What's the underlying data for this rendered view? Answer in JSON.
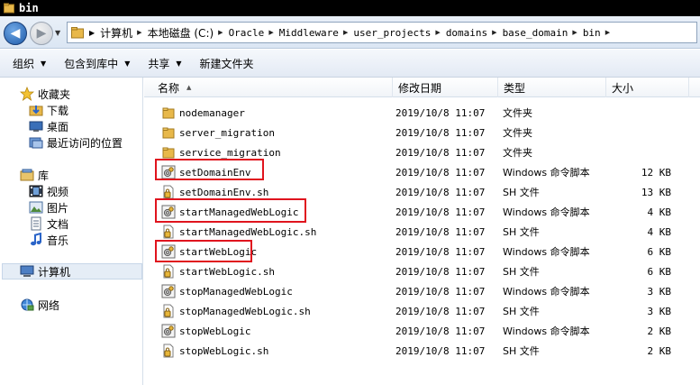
{
  "window": {
    "title": "bin"
  },
  "address": {
    "crumbs": [
      "计算机",
      "本地磁盘 (C:)",
      "Oracle",
      "Middleware",
      "user_projects",
      "domains",
      "base_domain",
      "bin"
    ]
  },
  "toolbar": {
    "organize": "组织",
    "include_in_library": "包含到库中",
    "share": "共享",
    "new_folder": "新建文件夹"
  },
  "navpane": {
    "favorites": "收藏夹",
    "downloads": "下载",
    "desktop": "桌面",
    "recent": "最近访问的位置",
    "libraries": "库",
    "videos": "视频",
    "pictures": "图片",
    "documents": "文档",
    "music": "音乐",
    "computer": "计算机",
    "network": "网络"
  },
  "columns": {
    "name": "名称",
    "date": "修改日期",
    "type": "类型",
    "size": "大小"
  },
  "files": [
    {
      "name": "nodemanager",
      "date": "2019/10/8 11:07",
      "type": "文件夹",
      "size": "",
      "icon": "folder-icon"
    },
    {
      "name": "server_migration",
      "date": "2019/10/8 11:07",
      "type": "文件夹",
      "size": "",
      "icon": "folder-icon"
    },
    {
      "name": "service_migration",
      "date": "2019/10/8 11:07",
      "type": "文件夹",
      "size": "",
      "icon": "folder-icon"
    },
    {
      "name": "setDomainEnv",
      "date": "2019/10/8 11:07",
      "type": "Windows 命令脚本",
      "size": "12 KB",
      "icon": "batch-file-icon"
    },
    {
      "name": "setDomainEnv.sh",
      "date": "2019/10/8 11:07",
      "type": "SH 文件",
      "size": "13 KB",
      "icon": "sh-file-icon"
    },
    {
      "name": "startManagedWebLogic",
      "date": "2019/10/8 11:07",
      "type": "Windows 命令脚本",
      "size": "4 KB",
      "icon": "batch-file-icon"
    },
    {
      "name": "startManagedWebLogic.sh",
      "date": "2019/10/8 11:07",
      "type": "SH 文件",
      "size": "4 KB",
      "icon": "sh-file-icon"
    },
    {
      "name": "startWebLogic",
      "date": "2019/10/8 11:07",
      "type": "Windows 命令脚本",
      "size": "6 KB",
      "icon": "batch-file-icon"
    },
    {
      "name": "startWebLogic.sh",
      "date": "2019/10/8 11:07",
      "type": "SH 文件",
      "size": "6 KB",
      "icon": "sh-file-icon"
    },
    {
      "name": "stopManagedWebLogic",
      "date": "2019/10/8 11:07",
      "type": "Windows 命令脚本",
      "size": "3 KB",
      "icon": "batch-file-icon"
    },
    {
      "name": "stopManagedWebLogic.sh",
      "date": "2019/10/8 11:07",
      "type": "SH 文件",
      "size": "3 KB",
      "icon": "sh-file-icon"
    },
    {
      "name": "stopWebLogic",
      "date": "2019/10/8 11:07",
      "type": "Windows 命令脚本",
      "size": "2 KB",
      "icon": "batch-file-icon"
    },
    {
      "name": "stopWebLogic.sh",
      "date": "2019/10/8 11:07",
      "type": "SH 文件",
      "size": "2 KB",
      "icon": "sh-file-icon"
    }
  ],
  "colors": {
    "highlight": "#e0141e",
    "folder": "#e8b84a",
    "selection": "#e5edf6"
  }
}
